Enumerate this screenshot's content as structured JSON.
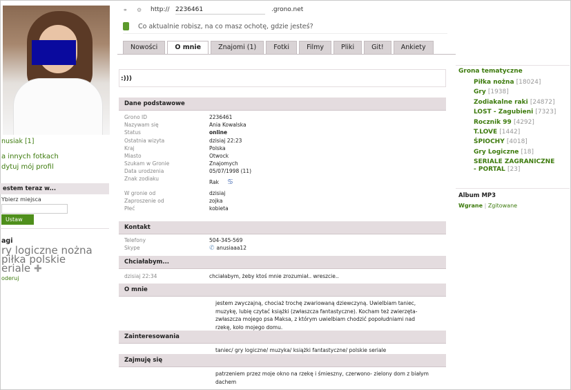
{
  "profile": {
    "nick": "nusiak [1]",
    "links": [
      "a innych fotkach",
      "dytuj mój profil"
    ],
    "where_head": "estem teraz w...",
    "where_label": "Ybierz miejsca",
    "set_button": "Ustaw",
    "tags_head": "agi",
    "tags": [
      "ry logiczne",
      "nożna",
      "piłka",
      "polskie",
      "eriale"
    ],
    "tags_edit": "oderuj"
  },
  "urlbar": {
    "scheme": "http://",
    "id": "2236461",
    "domain": ".grono.net"
  },
  "status": {
    "placeholder": "Co aktualnie robisz, na co masz ochotę, gdzie jesteś?"
  },
  "tabs": [
    {
      "label": "Nowości"
    },
    {
      "label": "O mnie"
    },
    {
      "label": "Znajomi (1)"
    },
    {
      "label": "Fotki"
    },
    {
      "label": "Filmy"
    },
    {
      "label": "Pliki"
    },
    {
      "label": "Git!"
    },
    {
      "label": "Ankiety"
    }
  ],
  "shout": ":)))",
  "basic": {
    "title": "Dane podstawowe",
    "rows": [
      {
        "k": "Grono ID",
        "v": "2236461"
      },
      {
        "k": "Nazywam się",
        "v": "Ania Kowalska"
      },
      {
        "k": "Status",
        "v": "online"
      },
      {
        "k": "Ostatnia wizyta",
        "v": "dzisiaj 22:23"
      },
      {
        "k": "Kraj",
        "v": "Polska"
      },
      {
        "k": "Miasto",
        "v": "Otwock"
      },
      {
        "k": "Szukam w Gronie",
        "v": "Znajomych"
      },
      {
        "k": "Data urodzenia",
        "v": "05/07/1998 (11)"
      },
      {
        "k": "Znak zodiaku",
        "v": "Rak"
      }
    ],
    "rows2": [
      {
        "k": "W gronie od",
        "v": "dzisiaj"
      },
      {
        "k": "Zaproszenie od",
        "v": "zojka"
      },
      {
        "k": "Płeć",
        "v": "kobieta"
      }
    ]
  },
  "contact": {
    "title": "Kontakt",
    "rows": [
      {
        "k": "Telefony",
        "v": "504-345-569"
      },
      {
        "k": "Skype",
        "v": "anusiaaa12"
      }
    ]
  },
  "wish": {
    "title": "Chciałabym...",
    "time": "dzisiaj 22:34",
    "text": "chciałabym, żeby ktoś mnie zrozumiał.. wreszcie.."
  },
  "about": {
    "title": "O mnie",
    "text": "jestem zwyczajną, chociaż trochę zwariowaną dziewczyną. Uwielbiam taniec, muzykę, lubię czytać książki (zwłaszcza fantastyczne). Kocham też zwierzęta-zwłaszcza mojego psa Maksa, z którym uwielbiam chodzić popołudniami nad rzekę, koło mojego domu."
  },
  "interests": {
    "title": "Zainteresowania",
    "text": "taniec/ gry logiczne/ muzyka/ książki fantastyczne/ polskie seriale"
  },
  "occupation": {
    "title": "Zajmuję się",
    "text": "patrzeniem przez moje okno na rzekę i śmieszny, czerwono- zielony dom z białym dachem"
  },
  "groups": {
    "title": "Grona tematyczne",
    "items": [
      {
        "name": "Piłka nożna",
        "count": "[18024]"
      },
      {
        "name": "Gry",
        "count": "[1938]"
      },
      {
        "name": "Zodiakalne raki",
        "count": "[24872]"
      },
      {
        "name": "LOST - Zagubieni",
        "count": "[7323]"
      },
      {
        "name": "Rocznik 99",
        "count": "[4292]"
      },
      {
        "name": "T.LOVE",
        "count": "[1442]"
      },
      {
        "name": "ŚPIOCHY",
        "count": "[4018]"
      },
      {
        "name": "Gry Logiczne",
        "count": "[18]"
      },
      {
        "name": "SERIALE ZAGRANICZNE - PORTAL",
        "count": "[23]"
      }
    ]
  },
  "album": {
    "title": "Album MP3",
    "upload": "Wgrane",
    "separator": "|",
    "tagged": "Zgitowane"
  },
  "colors": {
    "accent": "#3c7a0c",
    "section": "#e4dcdf",
    "censor": "#0a0a9e"
  }
}
